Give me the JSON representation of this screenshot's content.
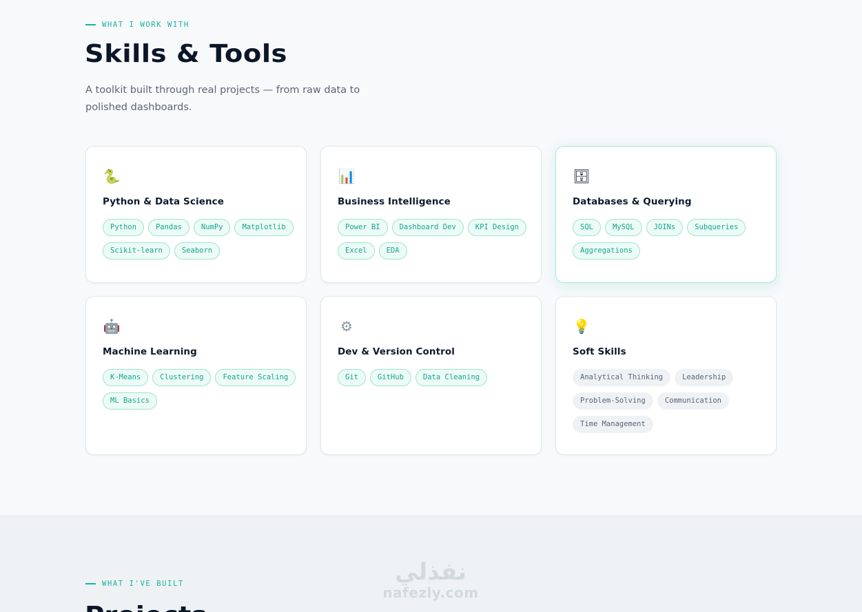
{
  "skills_section": {
    "eyebrow": "WHAT I WORK WITH",
    "title": "Skills & Tools",
    "subtitle": "A toolkit built through real projects — from raw data to polished dashboards.",
    "cards": [
      {
        "icon": "snake-icon",
        "icon_glyph": "🐍",
        "title": "Python & Data Science",
        "tags": [
          "Python",
          "Pandas",
          "NumPy",
          "Matplotlib",
          "Scikit-learn",
          "Seaborn"
        ]
      },
      {
        "icon": "bar-chart-icon",
        "icon_glyph": "📊",
        "title": "Business Intelligence",
        "tags": [
          "Power BI",
          "Dashboard Dev",
          "KPI Design",
          "Excel",
          "EDA"
        ]
      },
      {
        "icon": "file-cabinet-icon",
        "icon_glyph": "🗄",
        "title": "Databases & Querying",
        "tags": [
          "SQL",
          "MySQL",
          "JOINs",
          "Subqueries",
          "Aggregations"
        ]
      },
      {
        "icon": "robot-icon",
        "icon_glyph": "🤖",
        "title": "Machine Learning",
        "tags": [
          "K-Means",
          "Clustering",
          "Feature Scaling",
          "ML Basics"
        ]
      },
      {
        "icon": "gear-icon",
        "icon_glyph": "⚙",
        "title": "Dev & Version Control",
        "tags": [
          "Git",
          "GitHub",
          "Data Cleaning"
        ]
      },
      {
        "icon": "light-bulb-icon",
        "icon_glyph": "💡",
        "title": "Soft Skills",
        "tags": [
          "Analytical Thinking",
          "Leadership",
          "Problem-Solving",
          "Communication",
          "Time Management"
        ]
      }
    ]
  },
  "projects_section": {
    "eyebrow": "WHAT I'VE BUILT",
    "title": "Projects"
  },
  "watermark": {
    "arabic": "نفذلي",
    "latin": "nafezly.com"
  },
  "colors": {
    "accent": "#17b39a",
    "heading": "#0c1628",
    "background": "#f7f9fb"
  }
}
